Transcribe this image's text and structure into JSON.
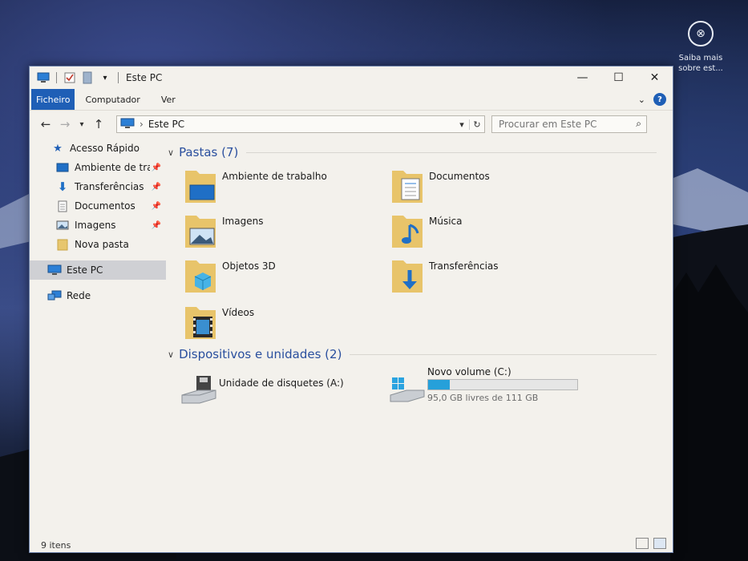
{
  "window": {
    "title": "Este PC",
    "controls": {
      "minimize": "—",
      "maximize": "☐",
      "close": "✕"
    }
  },
  "ribbon": {
    "tabs": [
      "Ficheiro",
      "Computador",
      "Ver"
    ]
  },
  "address": {
    "location": "Este PC"
  },
  "search": {
    "placeholder": "Procurar em Este PC"
  },
  "nav": {
    "quick_access": "Acesso Rápido",
    "items": [
      {
        "label": "Ambiente de trabalho",
        "icon": "desktop-icon",
        "pinned": true
      },
      {
        "label": "Transferências",
        "icon": "download-icon",
        "pinned": true
      },
      {
        "label": "Documentos",
        "icon": "documents-icon",
        "pinned": true
      },
      {
        "label": "Imagens",
        "icon": "pictures-icon",
        "pinned": true
      },
      {
        "label": "Nova pasta",
        "icon": "folder-icon",
        "pinned": false
      }
    ],
    "this_pc": "Este PC",
    "network": "Rede"
  },
  "groups": {
    "folders": {
      "title": "Pastas (7)",
      "items": [
        "Ambiente de trabalho",
        "Documentos",
        "Imagens",
        "Música",
        "Objetos 3D",
        "Transferências",
        "Vídeos"
      ]
    },
    "devices": {
      "title": "Dispositivos e unidades (2)",
      "floppy": "Unidade de disquetes (A:)",
      "volume": {
        "name": "Novo volume (C:)",
        "free_text": "95,0 GB livres de 111 GB",
        "used_fraction": 0.144
      }
    }
  },
  "status": {
    "count": "9 itens"
  },
  "desktop": {
    "notify_text": "Saiba mais sobre est..."
  },
  "colors": {
    "accent": "#1f5fb6",
    "group_title": "#2a4f9e",
    "drive_bar": "#26a0da"
  }
}
